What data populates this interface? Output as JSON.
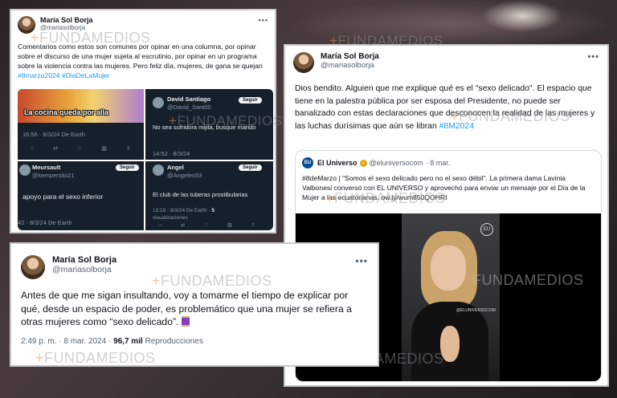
{
  "watermark": "FUNDAMEDIOS",
  "tweet1": {
    "name": "María Sol Borja",
    "handle": "@mariasolborja",
    "menu": "•••",
    "text": "Comentarios como estos son comunes por opinar en una columna, por opinar sobre el discurso de una mujer sujeta al escrutinio, por opinar en un programa sobre la violencia contra las mujeres. Pero feliz día, mujeres, de gana se  quejan",
    "hashtags": "#8marzo2024 #DiaDeLaMujer",
    "replies": [
      {
        "meme_text": "La cocina queda por alla",
        "timestamp": "16:56 · 8/3/24 De Earth"
      },
      {
        "name": "David Santiago",
        "handle": "@David_Sant00",
        "follow": "Seguir",
        "text": "No sea sufridora mijita, busque marido",
        "timestamp": "14:52 · 8/3/24"
      },
      {
        "name": "Meursault",
        "handle": "@kempersito21",
        "follow": "Seguir",
        "text": "apoyo para el sexo inferior",
        "timestamp": "42 · 8/3/24 De Earth"
      },
      {
        "name": "Angel",
        "handle": "@Angeleo53",
        "follow": "Seguir",
        "text": "El club de las tuberas prostibularias",
        "timestamp": "13:19 · 8/3/24 De Earth ·",
        "views_count": "5",
        "views_label": "visualizaciones"
      }
    ],
    "action_icons": "○ ⇄ ♡ ▥ ⇪"
  },
  "tweet2": {
    "name": "María Sol Borja",
    "handle": "@mariasolborja",
    "menu": "•••",
    "text": "Dios bendito. Alguien que me explique qué es el \"sexo delicado\". El espacio que tiene en la palestra pública por ser esposa del Presidente, no puede ser banalizado con estas declaraciones que desconocen la realidad  de las mujeres y las luchas durísimas que aún se libran",
    "hashtag": "#8M2024",
    "quote": {
      "logo": "EU",
      "name": "El Universo",
      "handle": "@eluniversocom",
      "date": "· 8 mar.",
      "text": "#8deMarzo | \"Somos el sexo delicado pero no el sexo débil\". La primera dama Lavinia Valbonesi conversó con EL UNIVERSO y aprovechó para enviar un mensaje por el Día de la Mujer a las ecuatorianas.",
      "link": "ow.ly/wum850QOHRI",
      "video_handle": "@ELUNIVERSOCOM",
      "video_badge": "EU"
    }
  },
  "tweet3": {
    "name": "María Sol Borja",
    "handle": "@mariasolborja",
    "menu": "•••",
    "text": "Antes de que me sigan insultando, voy a tomarme el tiempo de explicar por qué, desde un espacio de poder, es problemático que una mujer se refiera a otras mujeres como “sexo delicado”.",
    "time": "2:49 p. m. · 8 mar. 2024 ·",
    "views": "96,7 mil",
    "views_label": "Reproducciones"
  }
}
